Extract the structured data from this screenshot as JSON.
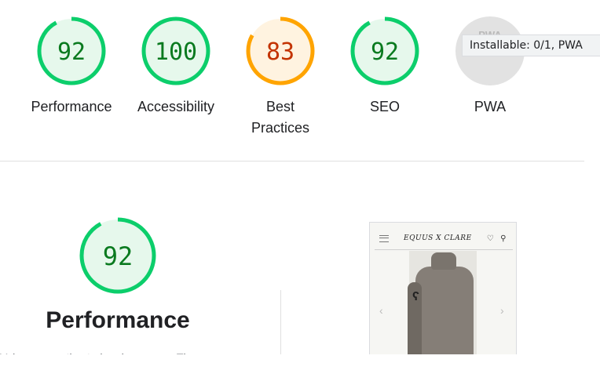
{
  "categories": [
    {
      "key": "performance",
      "score": "92",
      "label": [
        "Performance"
      ],
      "color": "#0cce6b",
      "text_color": "#0a7a1f",
      "fill": "#e6f8ec"
    },
    {
      "key": "accessibility",
      "score": "100",
      "label": [
        "Accessibility"
      ],
      "color": "#0cce6b",
      "text_color": "#0a7a1f",
      "fill": "#e6f8ec"
    },
    {
      "key": "best-practices",
      "score": "83",
      "label": [
        "Best",
        "Practices"
      ],
      "color": "#ffa400",
      "text_color": "#c33300",
      "fill": "#fff3e0"
    },
    {
      "key": "seo",
      "score": "92",
      "label": [
        "SEO"
      ],
      "color": "#0cce6b",
      "text_color": "#0a7a1f",
      "fill": "#e6f8ec"
    },
    {
      "key": "pwa",
      "score": "PWA",
      "label": [
        "PWA"
      ],
      "color": "#d9d9d9",
      "text_color": "#b7b7b7",
      "fill": "#ececec"
    }
  ],
  "tooltip": "Installable: 0/1, PWA",
  "performance_section": {
    "score": "92",
    "title": "Performance",
    "description": "Values are estimated and may vary. The"
  },
  "thumbnail": {
    "brand": "EQUUS X CLARE",
    "heart_icon": "♡",
    "user_icon": "⚲"
  },
  "colors": {
    "pass": "#0cce6b",
    "average": "#ffa400",
    "divider": "#e0e0e0"
  }
}
